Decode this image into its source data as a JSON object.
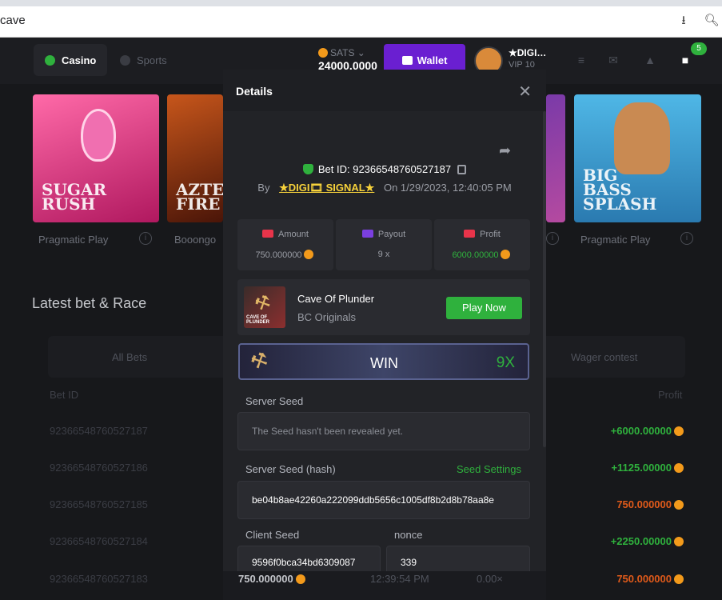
{
  "browser": {
    "url_text": "cave",
    "icons": [
      "download-icon",
      "zoom-icon"
    ]
  },
  "header": {
    "nav": [
      {
        "label": "Casino"
      },
      {
        "label": "Sports"
      }
    ],
    "currency": "SATS",
    "balance": "24000.0000",
    "wallet_label": "Wallet",
    "user_name": "★DIGI…",
    "vip": "VIP 10",
    "chat_count": "5"
  },
  "games": [
    {
      "title": "SUGAR RUSH",
      "provider": "Pragmatic Play"
    },
    {
      "title": "AZTEC FIRE",
      "provider": "Booongo"
    },
    {
      "title": "BIG BASS SPLASH",
      "provider": "Pragmatic Play"
    }
  ],
  "section_title": "Latest bet & Race",
  "bets_tabs": [
    "All Bets",
    "Wager contest"
  ],
  "columns": {
    "bet_id": "Bet ID",
    "profit": "Profit"
  },
  "bets": [
    {
      "id": "92366548760527187",
      "profit": "+6000.00000",
      "color": "#2fb13d"
    },
    {
      "id": "92366548760527186",
      "profit": "+1125.00000",
      "color": "#2fb13d"
    },
    {
      "id": "92366548760527185",
      "profit": "750.000000",
      "color": "#e05a1a"
    },
    {
      "id": "92366548760527184",
      "profit": "+2250.00000",
      "color": "#2fb13d"
    },
    {
      "id": "92366548760527183",
      "profit": "750.000000",
      "color": "#e05a1a"
    }
  ],
  "last_row": {
    "amount": "750.000000",
    "time": "12:39:54 PM",
    "payout": "0.00×"
  },
  "modal": {
    "title": "Details",
    "bet_id_text": "Bet ID: 92366548760527187",
    "by": "By",
    "user": "★DIGI🎞 SIGNAL★",
    "on_date": "On 1/29/2023, 12:40:05 PM",
    "stats": {
      "amount_label": "Amount",
      "amount_value": "750.000000",
      "payout_label": "Payout",
      "payout_value": "9 x",
      "profit_label": "Profit",
      "profit_value": "6000.00000"
    },
    "game": {
      "name": "Cave Of Plunder",
      "provider": "BC Originals",
      "play_label": "Play Now",
      "thumb_text": "CAVE OF PLUNDER"
    },
    "result": {
      "text": "WIN",
      "multiplier": "9X"
    },
    "server_seed_label": "Server Seed",
    "server_seed_value": "The Seed hasn't been revealed yet.",
    "server_hash_label": "Server Seed (hash)",
    "seed_settings": "Seed Settings",
    "server_hash_value": "be04b8ae42260a222099ddb5656c1005df8b2d8b78aa8e",
    "client_seed_label": "Client Seed",
    "nonce_label": "nonce",
    "client_seed_value": "9596f0bca34bd6309087",
    "nonce_value": "339"
  },
  "colors": {
    "accent_green": "#2fb13d",
    "wallet_purple": "#6a1fd1",
    "coin": "#f39a1b",
    "username_yellow": "#f7d23b"
  }
}
